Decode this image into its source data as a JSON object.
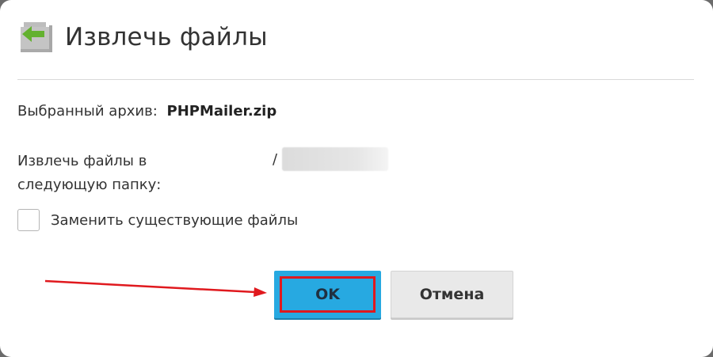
{
  "dialog": {
    "title": "Извлечь файлы",
    "icon": "extract-files-icon",
    "accent_color": "#27a9e1"
  },
  "archive": {
    "label": "Выбранный архив:",
    "value": "PHPMailer.zip"
  },
  "target": {
    "label": "Извлечь файлы в следующую папку:",
    "path_prefix": "/"
  },
  "replace_option": {
    "label": "Заменить существующие файлы",
    "checked": false
  },
  "buttons": {
    "ok_label": "OK",
    "cancel_label": "Отмена"
  },
  "annotation": {
    "highlight_color": "#e0191e"
  }
}
